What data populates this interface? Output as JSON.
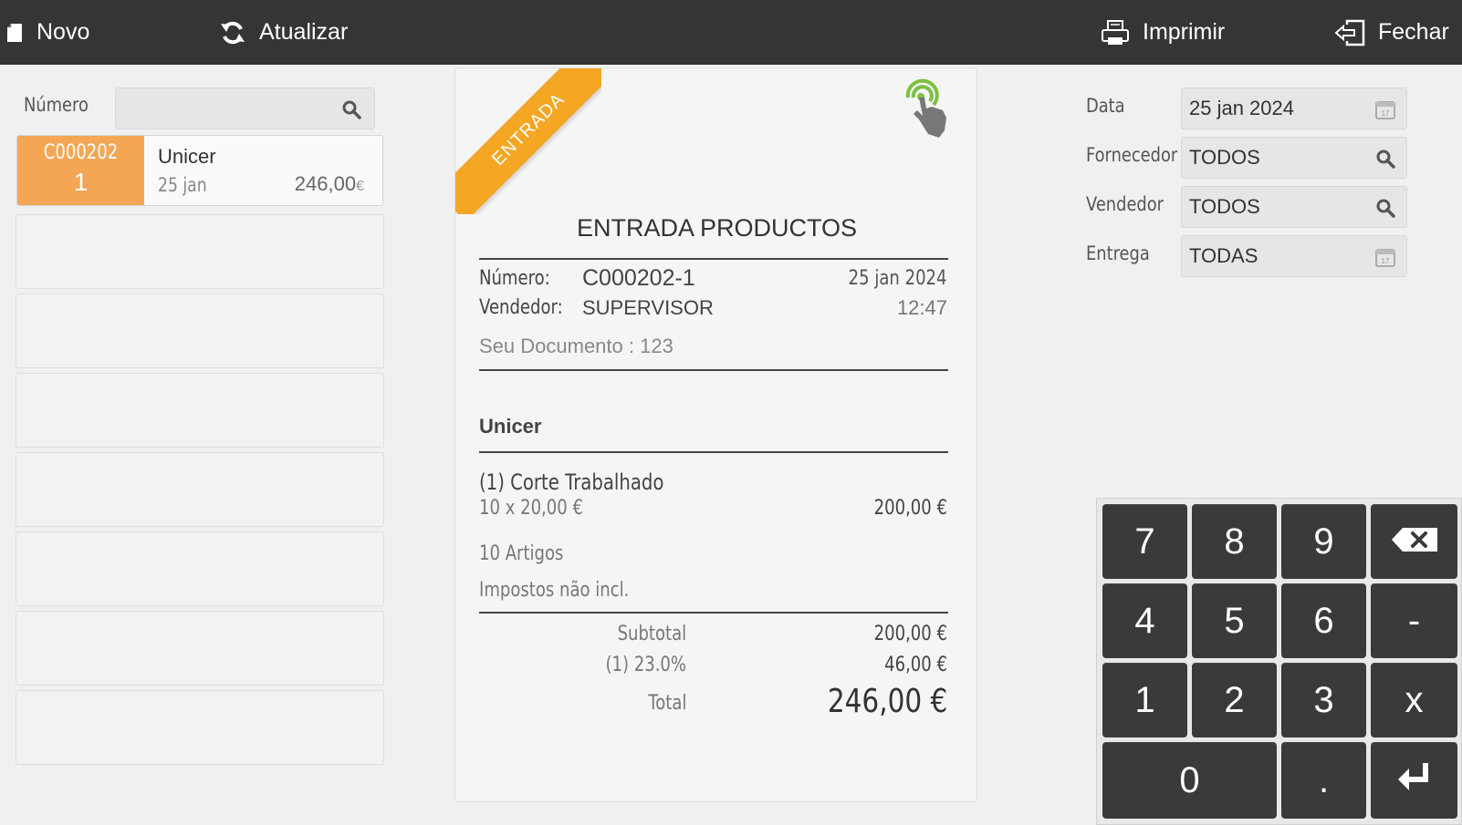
{
  "toolbar": {
    "new_label": "Novo",
    "refresh_label": "Atualizar",
    "print_label": "Imprimir",
    "close_label": "Fechar"
  },
  "search": {
    "number_label": "Número",
    "number_value": ""
  },
  "documents": [
    {
      "code": "C000202",
      "seq": "1",
      "name": "Unicer",
      "date": "25 jan",
      "amount": "246,00",
      "currency": "€"
    }
  ],
  "receipt": {
    "ribbon": "ENTRADA",
    "title": "ENTRADA PRODUCTOS",
    "number_label": "Número:",
    "number_value": "C000202-1",
    "date": "25 jan 2024",
    "seller_label": "Vendedor:",
    "seller_value": "SUPERVISOR",
    "time": "12:47",
    "your_document": "Seu Documento : 123",
    "supplier": "Unicer",
    "item_name": "(1) Corte Trabalhado",
    "item_qty_price": "10 x 20,00 €",
    "item_total": "200,00 €",
    "articles": "10 Artigos",
    "taxes_note": "Impostos não incl.",
    "subtotal_label": "Subtotal",
    "subtotal_value": "200,00 €",
    "tax_label": "(1) 23.0%",
    "tax_value": "46,00 €",
    "total_label": "Total",
    "total_value": "246,00 €"
  },
  "filters": {
    "date_label": "Data",
    "date_value": "25 jan 2024",
    "supplier_label": "Fornecedor",
    "supplier_value": "TODOS",
    "seller_label": "Vendedor",
    "seller_value": "TODOS",
    "delivery_label": "Entrega",
    "delivery_value": "TODAS"
  },
  "keypad": {
    "k7": "7",
    "k8": "8",
    "k9": "9",
    "k4": "4",
    "k5": "5",
    "k6": "6",
    "minus": "-",
    "k1": "1",
    "k2": "2",
    "k3": "3",
    "times": "x",
    "k0": "0",
    "dot": "."
  },
  "icons": {
    "new": "document-icon",
    "refresh": "refresh-icon",
    "print": "printer-icon",
    "close": "exit-icon",
    "search": "search-icon",
    "calendar": "calendar-icon",
    "touch": "touch-icon",
    "backspace": "backspace-icon",
    "enter": "enter-icon"
  },
  "colors": {
    "topbar": "#353535",
    "accent": "#f5a654",
    "ribbon": "#f5a623",
    "touch_icon": "#7cc142",
    "key": "#3a3a3a"
  }
}
